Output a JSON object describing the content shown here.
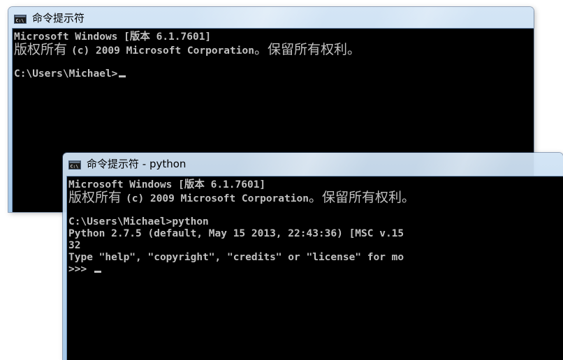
{
  "back_window": {
    "title": "命令提示符",
    "icon": "console-icon",
    "lines": {
      "l1": "Microsoft Windows [版本 6.1.7601]",
      "l2a": "版权所有 ",
      "l2b": "(c) 2009 Microsoft Corporation",
      "l2c": "。保留所有权利。",
      "l3": "",
      "l4": "C:\\Users\\Michael>"
    }
  },
  "front_window": {
    "title": "命令提示符 - python",
    "icon": "console-icon",
    "lines": {
      "l1": "Microsoft Windows [版本 6.1.7601]",
      "l2a": "版权所有 ",
      "l2b": "(c) 2009 Microsoft Corporation",
      "l2c": "。保留所有权利。",
      "l3": "",
      "l4": "C:\\Users\\Michael>python",
      "l5": "Python 2.7.5 (default, May 15 2013, 22:43:36) [MSC v.15",
      "l6": "32",
      "l7": "Type \"help\", \"copyright\", \"credits\" or \"license\" for mo",
      "l8": ">>> "
    }
  },
  "colors": {
    "console_background": "#000000",
    "console_text": "#c0c0c0",
    "titlebar": "#b9d3ee"
  }
}
